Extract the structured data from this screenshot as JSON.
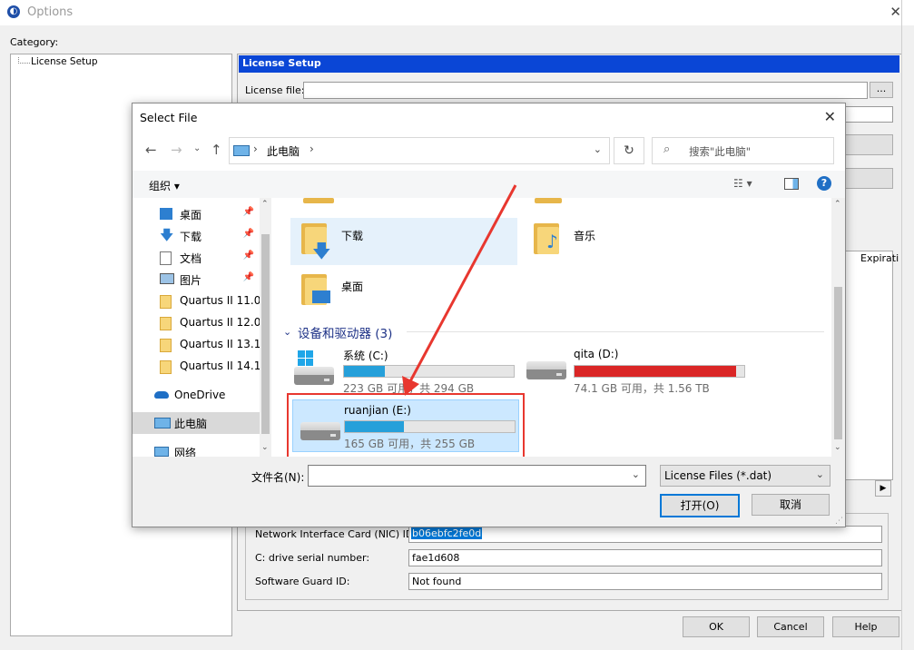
{
  "window": {
    "title": "Options",
    "close": "✕"
  },
  "category_label": "Category:",
  "tree": {
    "item": "License Setup"
  },
  "section": {
    "title": "License Setup",
    "license_file_label": "License file:",
    "license_file_value": "",
    "browse_label": "...",
    "column_header": "Expirati",
    "nic_label": "Network Interface Card (NIC) ID:",
    "nic_value": "b06ebfc2fe0d",
    "serial_label": "C: drive serial number:",
    "serial_value": "fae1d608",
    "guard_label": "Software Guard ID:",
    "guard_value": "Not found"
  },
  "footer": {
    "ok": "OK",
    "cancel": "Cancel",
    "help": "Help"
  },
  "dialog": {
    "title": "Select File",
    "close": "✕",
    "breadcrumb": "此电脑",
    "search_placeholder": "搜索\"此电脑\"",
    "organize": "组织",
    "nav_items": [
      {
        "label": "桌面",
        "icon": "desktop-icon",
        "pinned": true
      },
      {
        "label": "下载",
        "icon": "download-icon",
        "pinned": true
      },
      {
        "label": "文档",
        "icon": "document-icon",
        "pinned": true
      },
      {
        "label": "图片",
        "icon": "picture-icon",
        "pinned": true
      },
      {
        "label": "Quartus II 11.0",
        "icon": "folder-icon",
        "pinned": false
      },
      {
        "label": "Quartus II 12.0",
        "icon": "folder-icon",
        "pinned": false
      },
      {
        "label": "Quartus II 13.1",
        "icon": "folder-icon",
        "pinned": false
      },
      {
        "label": "Quartus II 14.1",
        "icon": "folder-icon",
        "pinned": false
      },
      {
        "label": "OneDrive",
        "icon": "cloud-icon",
        "pinned": false
      },
      {
        "label": "此电脑",
        "icon": "computer-icon",
        "pinned": false
      },
      {
        "label": "网络",
        "icon": "network-icon",
        "pinned": false
      }
    ],
    "folders": [
      {
        "label": "下载"
      },
      {
        "label": "音乐"
      },
      {
        "label": "桌面"
      }
    ],
    "drives_group": "设备和驱动器 (3)",
    "drives": [
      {
        "label": "系统 (C:)",
        "free": "223 GB 可用，共 294 GB",
        "used_fraction": 0.24,
        "color": "#26a0da"
      },
      {
        "label": "qita (D:)",
        "free": "74.1 GB 可用，共 1.56 TB",
        "used_fraction": 0.95,
        "color": "#da2626"
      },
      {
        "label": "ruanjian (E:)",
        "free": "165 GB 可用，共 255 GB",
        "used_fraction": 0.35,
        "color": "#26a0da"
      }
    ],
    "filename_label": "文件名(N):",
    "filename_value": "",
    "filter": "License Files (*.dat)",
    "open": "打开(O)",
    "cancel": "取消"
  },
  "colors": {
    "accent": "#0a46d6",
    "highlight": "#cce8ff",
    "annotation": "#e8372f"
  }
}
